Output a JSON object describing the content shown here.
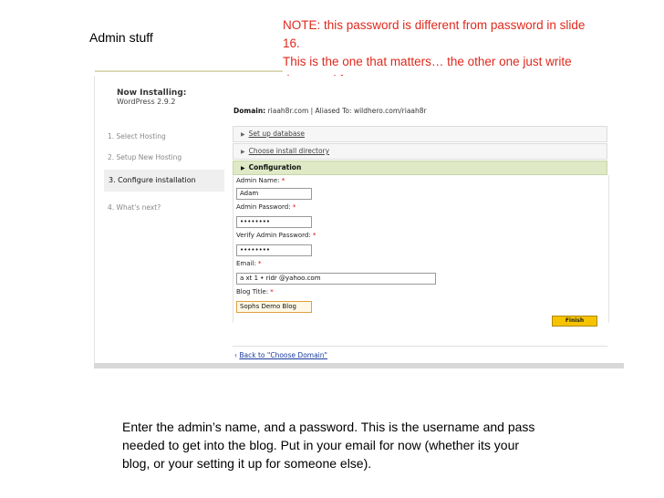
{
  "slide": {
    "title": "Admin stuff",
    "note_lines": [
      "NOTE: this password is different from password in slide",
      "16.",
      "This is the one that matters… the other one just write",
      "down and forget"
    ],
    "caption_lines": [
      "Enter the admin’s name, and a password. This is the username and pass",
      "needed to get into the blog. Put in your email for now (whether its your",
      "blog, or your setting it up for someone else)."
    ]
  },
  "installer": {
    "heading": "Now Installing:",
    "version": "WordPress 2.9.2",
    "steps": [
      "1. Select Hosting",
      "2. Setup New Hosting",
      "3. Configure installation",
      "4. What's next?"
    ],
    "domain_label": "Domain:",
    "domain_value": "riaah8r.com",
    "aliased_label": "| Aliased To:",
    "aliased_value": "wildhero.com/riaah8r",
    "setup_database": "Set up database",
    "choose_install_directory": "Choose install directory",
    "configuration": "Configuration",
    "fields": {
      "admin_name_label": "Admin Name:",
      "admin_name_value": "Adam",
      "admin_password_label": "Admin Password:",
      "admin_password_value": "••••••••",
      "verify_password_label": "Verify Admin Password:",
      "verify_password_value": "••••••••",
      "email_label": "Email:",
      "email_value": "a    xt   1    •   ridr   @yahoo.com",
      "blog_title_label": "Blog Title:",
      "blog_title_value": "Sophs Demo Blog"
    },
    "required_mark": "*",
    "finish_label": "Finish",
    "back_arrow": "‹",
    "back_label": "Back to \"Choose Domain\""
  },
  "colors": {
    "note_red": "#e0281c",
    "config_header_bg": "#dfe9c6",
    "finish_button": "#f5c300",
    "link_blue": "#1a3c9c"
  }
}
